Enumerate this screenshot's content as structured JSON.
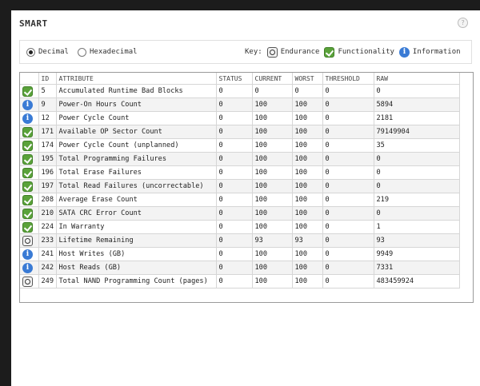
{
  "title": "SMART",
  "help_label": "?",
  "format": {
    "options": [
      "Decimal",
      "Hexadecimal"
    ],
    "selected": "Decimal"
  },
  "key": {
    "label": "Key:",
    "items": [
      {
        "icon": "endurance-icon",
        "label": "Endurance"
      },
      {
        "icon": "functionality-icon",
        "label": "Functionality"
      },
      {
        "icon": "information-icon",
        "label": "Information"
      }
    ]
  },
  "table": {
    "headers": [
      "",
      "ID",
      "ATTRIBUTE",
      "STATUS",
      "CURRENT",
      "WORST",
      "THRESHOLD",
      "RAW"
    ],
    "rows": [
      {
        "type": "func",
        "id": "5",
        "attr": "Accumulated Runtime Bad Blocks",
        "status": "0",
        "current": "0",
        "worst": "0",
        "threshold": "0",
        "raw": "0"
      },
      {
        "type": "info",
        "id": "9",
        "attr": "Power-On Hours Count",
        "status": "0",
        "current": "100",
        "worst": "100",
        "threshold": "0",
        "raw": "5894"
      },
      {
        "type": "info",
        "id": "12",
        "attr": "Power Cycle Count",
        "status": "0",
        "current": "100",
        "worst": "100",
        "threshold": "0",
        "raw": "2181"
      },
      {
        "type": "func",
        "id": "171",
        "attr": "Available OP Sector Count",
        "status": "0",
        "current": "100",
        "worst": "100",
        "threshold": "0",
        "raw": "79149904"
      },
      {
        "type": "func",
        "id": "174",
        "attr": "Power Cycle Count (unplanned)",
        "status": "0",
        "current": "100",
        "worst": "100",
        "threshold": "0",
        "raw": "35"
      },
      {
        "type": "func",
        "id": "195",
        "attr": "Total Programming Failures",
        "status": "0",
        "current": "100",
        "worst": "100",
        "threshold": "0",
        "raw": "0"
      },
      {
        "type": "func",
        "id": "196",
        "attr": "Total Erase Failures",
        "status": "0",
        "current": "100",
        "worst": "100",
        "threshold": "0",
        "raw": "0"
      },
      {
        "type": "func",
        "id": "197",
        "attr": "Total Read Failures (uncorrectable)",
        "status": "0",
        "current": "100",
        "worst": "100",
        "threshold": "0",
        "raw": "0"
      },
      {
        "type": "func",
        "id": "208",
        "attr": "Average Erase Count",
        "status": "0",
        "current": "100",
        "worst": "100",
        "threshold": "0",
        "raw": "219"
      },
      {
        "type": "func",
        "id": "210",
        "attr": "SATA CRC Error Count",
        "status": "0",
        "current": "100",
        "worst": "100",
        "threshold": "0",
        "raw": "0"
      },
      {
        "type": "func",
        "id": "224",
        "attr": "In Warranty",
        "status": "0",
        "current": "100",
        "worst": "100",
        "threshold": "0",
        "raw": "1"
      },
      {
        "type": "endu",
        "id": "233",
        "attr": "Lifetime Remaining",
        "status": "0",
        "current": "93",
        "worst": "93",
        "threshold": "0",
        "raw": "93"
      },
      {
        "type": "info",
        "id": "241",
        "attr": "Host Writes (GB)",
        "status": "0",
        "current": "100",
        "worst": "100",
        "threshold": "0",
        "raw": "9949"
      },
      {
        "type": "info",
        "id": "242",
        "attr": "Host Reads (GB)",
        "status": "0",
        "current": "100",
        "worst": "100",
        "threshold": "0",
        "raw": "7331"
      },
      {
        "type": "endu",
        "id": "249",
        "attr": "Total NAND Programming Count (pages)",
        "status": "0",
        "current": "100",
        "worst": "100",
        "threshold": "0",
        "raw": "483459924"
      }
    ]
  },
  "colors": {
    "functionality": "#5aa23a",
    "information": "#3a7bd5",
    "row_alt": "#f3f3f3",
    "background": "#1c1c1c"
  }
}
